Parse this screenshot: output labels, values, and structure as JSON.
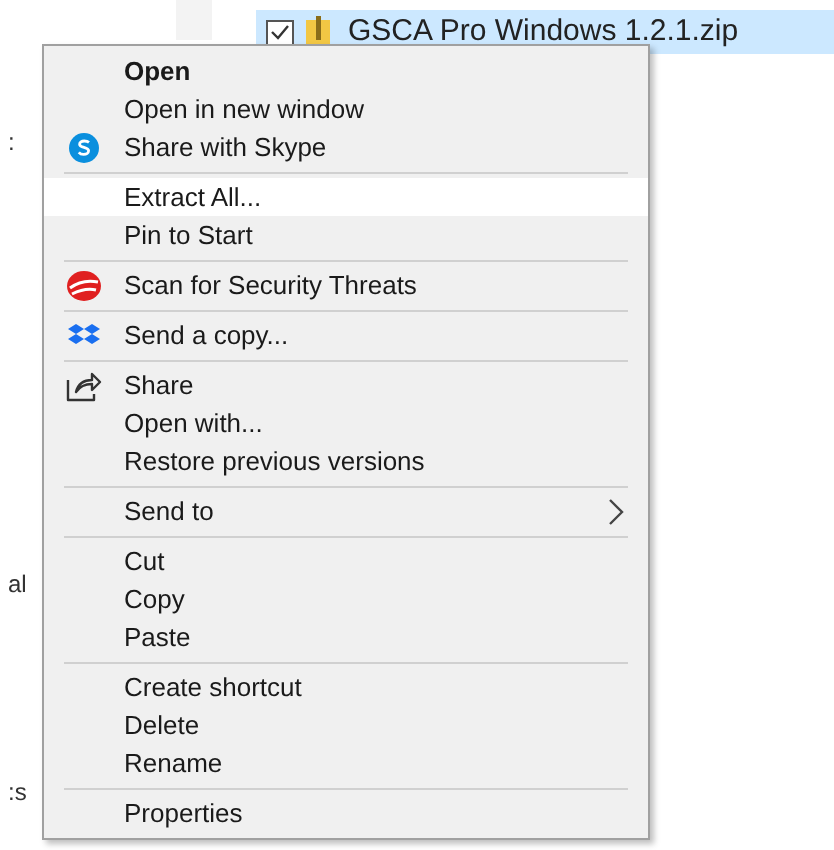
{
  "file_row": {
    "name": "GSCA Pro Windows 1.2.1.zip",
    "selected": true,
    "checked": true
  },
  "side_fragments": [
    ":",
    "al",
    ":s"
  ],
  "context_menu": {
    "groups": [
      [
        {
          "label": "Open",
          "kind": "plain",
          "default": true,
          "selected": false,
          "submenu": false
        },
        {
          "label": "Open in new window",
          "kind": "plain",
          "default": false,
          "selected": false,
          "submenu": false
        },
        {
          "label": "Share with Skype",
          "kind": "bubble",
          "default": false,
          "selected": false,
          "submenu": false
        }
      ],
      [
        {
          "label": "Extract All...",
          "kind": "plain",
          "default": false,
          "selected": true,
          "submenu": false
        },
        {
          "label": "Pin to Start",
          "kind": "plain",
          "default": false,
          "selected": false,
          "submenu": false
        }
      ],
      [
        {
          "label": "Scan for Security Threats",
          "kind": "swirl",
          "default": false,
          "selected": false,
          "submenu": false
        }
      ],
      [
        {
          "label": "Send a copy...",
          "kind": "boxes",
          "default": false,
          "selected": false,
          "submenu": false
        }
      ],
      [
        {
          "label": "Share",
          "kind": "share",
          "default": false,
          "selected": false,
          "submenu": false
        },
        {
          "label": "Open with...",
          "kind": "plain",
          "default": false,
          "selected": false,
          "submenu": false
        },
        {
          "label": "Restore previous versions",
          "kind": "plain",
          "default": false,
          "selected": false,
          "submenu": false
        }
      ],
      [
        {
          "label": "Send to",
          "kind": "plain",
          "default": false,
          "selected": false,
          "submenu": true
        }
      ],
      [
        {
          "label": "Cut",
          "kind": "plain",
          "default": false,
          "selected": false,
          "submenu": false
        },
        {
          "label": "Copy",
          "kind": "plain",
          "default": false,
          "selected": false,
          "submenu": false
        },
        {
          "label": "Paste",
          "kind": "plain",
          "default": false,
          "selected": false,
          "submenu": false
        }
      ],
      [
        {
          "label": "Create shortcut",
          "kind": "plain",
          "default": false,
          "selected": false,
          "submenu": false
        },
        {
          "label": "Delete",
          "kind": "plain",
          "default": false,
          "selected": false,
          "submenu": false
        },
        {
          "label": "Rename",
          "kind": "plain",
          "default": false,
          "selected": false,
          "submenu": false
        }
      ],
      [
        {
          "label": "Properties",
          "kind": "plain",
          "default": false,
          "selected": false,
          "submenu": false
        }
      ]
    ]
  }
}
